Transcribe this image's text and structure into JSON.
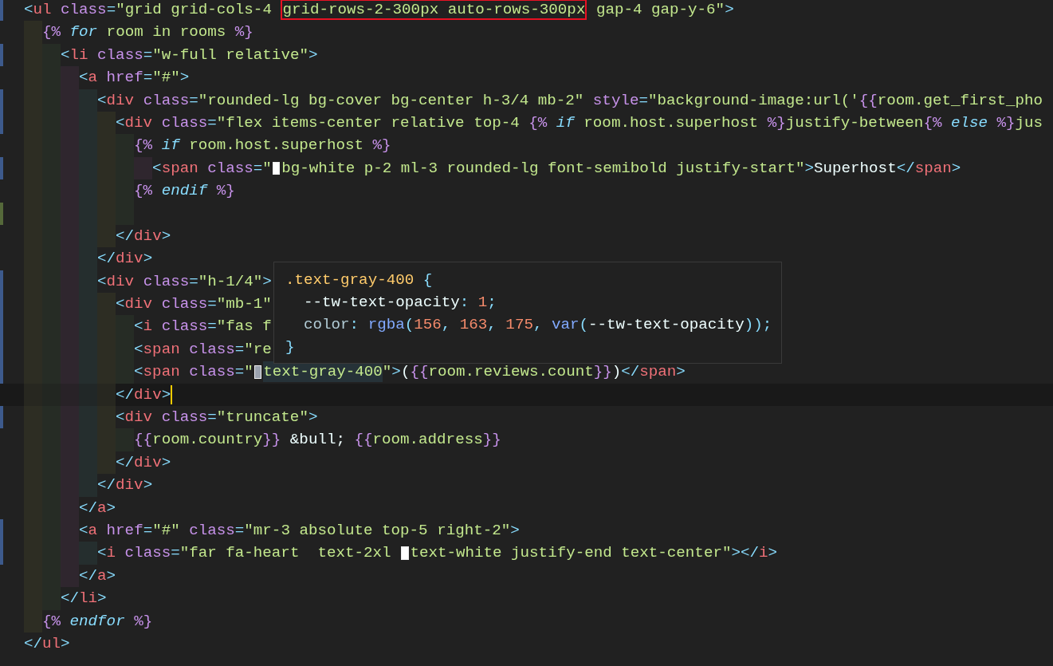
{
  "editor": {
    "lines": [
      {
        "color": "#3d5a8c",
        "tokens": [
          {
            "kind": "bracket",
            "text": "<"
          },
          {
            "kind": "tag",
            "text": "ul"
          },
          {
            "kind": "attr",
            "text": " class"
          },
          {
            "kind": "eq",
            "text": "="
          },
          {
            "kind": "str",
            "text": "\"grid grid-cols-4 "
          },
          {
            "kind": "str",
            "text": "grid-rows-2-300px auto-rows-300px",
            "boxed": true
          },
          {
            "kind": "str",
            "text": " gap-4 gap-y-6\""
          },
          {
            "kind": "bracket",
            "text": ">"
          }
        ]
      },
      {
        "tokens": [
          {
            "kind": "tpl",
            "text": "  {%"
          },
          {
            "kind": "kw",
            "text": " for"
          },
          {
            "kind": "var",
            "text": " room in rooms "
          },
          {
            "kind": "tpl",
            "text": "%}"
          }
        ]
      },
      {
        "color": "#3d5a8c",
        "tokens": [
          {
            "kind": "bracket",
            "text": "    <"
          },
          {
            "kind": "tag",
            "text": "li"
          },
          {
            "kind": "attr",
            "text": " class"
          },
          {
            "kind": "eq",
            "text": "="
          },
          {
            "kind": "str",
            "text": "\"w-full relative\""
          },
          {
            "kind": "bracket",
            "text": ">"
          }
        ]
      },
      {
        "tokens": [
          {
            "kind": "bracket",
            "text": "      <"
          },
          {
            "kind": "tag",
            "text": "a"
          },
          {
            "kind": "attr",
            "text": " href"
          },
          {
            "kind": "eq",
            "text": "="
          },
          {
            "kind": "str",
            "text": "\"#\""
          },
          {
            "kind": "bracket",
            "text": ">"
          }
        ]
      },
      {
        "color": "#3d5a8c",
        "tokens": [
          {
            "kind": "bracket",
            "text": "        <"
          },
          {
            "kind": "tag",
            "text": "div"
          },
          {
            "kind": "attr",
            "text": " class"
          },
          {
            "kind": "eq",
            "text": "="
          },
          {
            "kind": "str",
            "text": "\"rounded-lg bg-cover bg-center h-3/4 mb-2\""
          },
          {
            "kind": "attr",
            "text": " style"
          },
          {
            "kind": "eq",
            "text": "="
          },
          {
            "kind": "str",
            "text": "\"background-image:url('"
          },
          {
            "kind": "tpl",
            "text": "{{"
          },
          {
            "kind": "var",
            "text": "room.get_first_pho"
          }
        ]
      },
      {
        "color": "#3d5a8c",
        "tokens": [
          {
            "kind": "bracket",
            "text": "          <"
          },
          {
            "kind": "tag",
            "text": "div"
          },
          {
            "kind": "attr",
            "text": " class"
          },
          {
            "kind": "eq",
            "text": "="
          },
          {
            "kind": "str",
            "text": "\"flex items-center relative top-4 "
          },
          {
            "kind": "tpl",
            "text": "{%"
          },
          {
            "kind": "kw",
            "text": " if"
          },
          {
            "kind": "var",
            "text": " room.host.superhost "
          },
          {
            "kind": "tpl",
            "text": "%}"
          },
          {
            "kind": "str",
            "text": "justify-between"
          },
          {
            "kind": "tpl",
            "text": "{%"
          },
          {
            "kind": "kw",
            "text": " else"
          },
          {
            "kind": "tpl",
            "text": " %}"
          },
          {
            "kind": "str",
            "text": "jus"
          }
        ]
      },
      {
        "tokens": [
          {
            "kind": "tpl",
            "text": "            {%"
          },
          {
            "kind": "kw",
            "text": " if"
          },
          {
            "kind": "var",
            "text": " room.host.superhost "
          },
          {
            "kind": "tpl",
            "text": "%}"
          }
        ]
      },
      {
        "color": "#3d5a8c",
        "tokens": [
          {
            "kind": "bracket",
            "text": "              <"
          },
          {
            "kind": "tag",
            "text": "span"
          },
          {
            "kind": "attr",
            "text": " class"
          },
          {
            "kind": "eq",
            "text": "="
          },
          {
            "kind": "str",
            "text": "\""
          },
          {
            "kind": "swatch",
            "color": "#ffffff"
          },
          {
            "kind": "str",
            "text": "bg-white p-2 ml-3 rounded-lg font-semibold justify-start\""
          },
          {
            "kind": "bracket",
            "text": ">"
          },
          {
            "kind": "text",
            "text": "Superhost"
          },
          {
            "kind": "bracket",
            "text": "</"
          },
          {
            "kind": "tag",
            "text": "span"
          },
          {
            "kind": "bracket",
            "text": ">"
          }
        ]
      },
      {
        "tokens": [
          {
            "kind": "tpl",
            "text": "            {%"
          },
          {
            "kind": "kw",
            "text": " endif"
          },
          {
            "kind": "tpl",
            "text": " %}"
          }
        ]
      },
      {
        "color": "#55693a"
      },
      {
        "tokens": [
          {
            "kind": "bracket",
            "text": "          </"
          },
          {
            "kind": "tag",
            "text": "div"
          },
          {
            "kind": "bracket",
            "text": ">"
          }
        ]
      },
      {
        "tokens": [
          {
            "kind": "bracket",
            "text": "        </"
          },
          {
            "kind": "tag",
            "text": "div"
          },
          {
            "kind": "bracket",
            "text": ">"
          }
        ]
      },
      {
        "color": "#3d5a8c",
        "tokens": [
          {
            "kind": "bracket",
            "text": "        <"
          },
          {
            "kind": "tag",
            "text": "div"
          },
          {
            "kind": "attr",
            "text": " class"
          },
          {
            "kind": "eq",
            "text": "="
          },
          {
            "kind": "str",
            "text": "\"h-1/4\""
          },
          {
            "kind": "bracket",
            "text": ">"
          }
        ]
      },
      {
        "color": "#3d5a8c",
        "tokens": [
          {
            "kind": "bracket",
            "text": "          <"
          },
          {
            "kind": "tag",
            "text": "div"
          },
          {
            "kind": "attr",
            "text": " class"
          },
          {
            "kind": "eq",
            "text": "="
          },
          {
            "kind": "str",
            "text": "\"mb-1\""
          }
        ]
      },
      {
        "color": "#3d5a8c",
        "tokens": [
          {
            "kind": "bracket",
            "text": "            <"
          },
          {
            "kind": "tag",
            "text": "i"
          },
          {
            "kind": "attr",
            "text": " class"
          },
          {
            "kind": "eq",
            "text": "="
          },
          {
            "kind": "str",
            "text": "\"fas f"
          }
        ]
      },
      {
        "color": "#3d5a8c",
        "tokens": [
          {
            "kind": "bracket",
            "text": "            <"
          },
          {
            "kind": "tag",
            "text": "span"
          },
          {
            "kind": "attr",
            "text": " class"
          },
          {
            "kind": "eq",
            "text": "="
          },
          {
            "kind": "str",
            "text": "\"re"
          }
        ]
      },
      {
        "color": "#3d5a8c",
        "tokens": [
          {
            "kind": "bracket",
            "text": "            <"
          },
          {
            "kind": "tag",
            "text": "span"
          },
          {
            "kind": "attr",
            "text": " class"
          },
          {
            "kind": "eq",
            "text": "="
          },
          {
            "kind": "str",
            "text": "\""
          },
          {
            "kind": "swatch",
            "color": "#9ca3af"
          },
          {
            "kind": "str",
            "text": "text-gray-400",
            "highlighted": true
          },
          {
            "kind": "str",
            "text": "\""
          },
          {
            "kind": "bracket",
            "text": ">"
          },
          {
            "kind": "text",
            "text": "("
          },
          {
            "kind": "tpl",
            "text": "{{"
          },
          {
            "kind": "var",
            "text": "room.reviews.count"
          },
          {
            "kind": "tpl",
            "text": "}}"
          },
          {
            "kind": "text",
            "text": ")"
          },
          {
            "kind": "bracket",
            "text": "</"
          },
          {
            "kind": "tag",
            "text": "span"
          },
          {
            "kind": "bracket",
            "text": ">"
          }
        ]
      },
      {
        "current": true,
        "tokens": [
          {
            "kind": "bracket",
            "text": "          </"
          },
          {
            "kind": "tag",
            "text": "div"
          },
          {
            "kind": "bracket",
            "text": ">"
          }
        ]
      },
      {
        "color": "#3d5a8c",
        "tokens": [
          {
            "kind": "bracket",
            "text": "          <"
          },
          {
            "kind": "tag",
            "text": "div"
          },
          {
            "kind": "attr",
            "text": " class"
          },
          {
            "kind": "eq",
            "text": "="
          },
          {
            "kind": "str",
            "text": "\"truncate\""
          },
          {
            "kind": "bracket",
            "text": ">"
          }
        ]
      },
      {
        "tokens": [
          {
            "kind": "tpl",
            "text": "            {{"
          },
          {
            "kind": "var",
            "text": "room.country"
          },
          {
            "kind": "tpl",
            "text": "}}"
          },
          {
            "kind": "text",
            "text": " &bull; "
          },
          {
            "kind": "tpl",
            "text": "{{"
          },
          {
            "kind": "var",
            "text": "room.address"
          },
          {
            "kind": "tpl",
            "text": "}}"
          }
        ]
      },
      {
        "tokens": [
          {
            "kind": "bracket",
            "text": "          </"
          },
          {
            "kind": "tag",
            "text": "div"
          },
          {
            "kind": "bracket",
            "text": ">"
          }
        ]
      },
      {
        "tokens": [
          {
            "kind": "bracket",
            "text": "        </"
          },
          {
            "kind": "tag",
            "text": "div"
          },
          {
            "kind": "bracket",
            "text": ">"
          }
        ]
      },
      {
        "tokens": [
          {
            "kind": "bracket",
            "text": "      </"
          },
          {
            "kind": "tag",
            "text": "a"
          },
          {
            "kind": "bracket",
            "text": ">"
          }
        ]
      },
      {
        "color": "#3d5a8c",
        "tokens": [
          {
            "kind": "bracket",
            "text": "      <"
          },
          {
            "kind": "tag",
            "text": "a"
          },
          {
            "kind": "attr",
            "text": " href"
          },
          {
            "kind": "eq",
            "text": "="
          },
          {
            "kind": "str",
            "text": "\"#\""
          },
          {
            "kind": "attr",
            "text": " class"
          },
          {
            "kind": "eq",
            "text": "="
          },
          {
            "kind": "str",
            "text": "\"mr-3 absolute top-5 right-2\""
          },
          {
            "kind": "bracket",
            "text": ">"
          }
        ]
      },
      {
        "color": "#3d5a8c",
        "tokens": [
          {
            "kind": "bracket",
            "text": "        <"
          },
          {
            "kind": "tag",
            "text": "i"
          },
          {
            "kind": "attr",
            "text": " class"
          },
          {
            "kind": "eq",
            "text": "="
          },
          {
            "kind": "str",
            "text": "\"far fa-heart  text-2xl "
          },
          {
            "kind": "swatch",
            "color": "#ffffff"
          },
          {
            "kind": "str",
            "text": "text-white justify-end text-center\""
          },
          {
            "kind": "bracket",
            "text": "></"
          },
          {
            "kind": "tag",
            "text": "i"
          },
          {
            "kind": "bracket",
            "text": ">"
          }
        ]
      },
      {
        "tokens": [
          {
            "kind": "bracket",
            "text": "      </"
          },
          {
            "kind": "tag",
            "text": "a"
          },
          {
            "kind": "bracket",
            "text": ">"
          }
        ]
      },
      {
        "tokens": [
          {
            "kind": "bracket",
            "text": "    </"
          },
          {
            "kind": "tag",
            "text": "li"
          },
          {
            "kind": "bracket",
            "text": ">"
          }
        ]
      },
      {
        "tokens": [
          {
            "kind": "tpl",
            "text": "  {%"
          },
          {
            "kind": "kw",
            "text": " endfor"
          },
          {
            "kind": "tpl",
            "text": " %}"
          }
        ]
      },
      {
        "tokens": [
          {
            "kind": "bracket",
            "text": "</"
          },
          {
            "kind": "tag",
            "text": "ul"
          },
          {
            "kind": "bracket",
            "text": ">"
          }
        ]
      }
    ]
  },
  "hover_tooltip": {
    "lines": [
      {
        "tokens": [
          {
            "kind": "selector",
            "text": ".text-gray-400"
          },
          {
            "kind": "punct",
            "text": " {"
          }
        ]
      },
      {
        "tokens": [
          {
            "kind": "text",
            "text": "  --tw-text-opacity"
          },
          {
            "kind": "punct",
            "text": ":"
          },
          {
            "kind": "num",
            "text": " 1"
          },
          {
            "kind": "punct",
            "text": ";"
          }
        ]
      },
      {
        "tokens": [
          {
            "kind": "prop",
            "text": "  color"
          },
          {
            "kind": "punct",
            "text": ":"
          },
          {
            "kind": "func",
            "text": " rgba"
          },
          {
            "kind": "punct",
            "text": "("
          },
          {
            "kind": "num",
            "text": "156"
          },
          {
            "kind": "punct",
            "text": ","
          },
          {
            "kind": "num",
            "text": " 163"
          },
          {
            "kind": "punct",
            "text": ","
          },
          {
            "kind": "num",
            "text": " 175"
          },
          {
            "kind": "punct",
            "text": ","
          },
          {
            "kind": "func",
            "text": " var"
          },
          {
            "kind": "punct",
            "text": "("
          },
          {
            "kind": "text",
            "text": "--tw-text-opacity"
          },
          {
            "kind": "punct",
            "text": "));"
          }
        ]
      },
      {
        "tokens": [
          {
            "kind": "punct",
            "text": "}"
          }
        ]
      }
    ]
  }
}
